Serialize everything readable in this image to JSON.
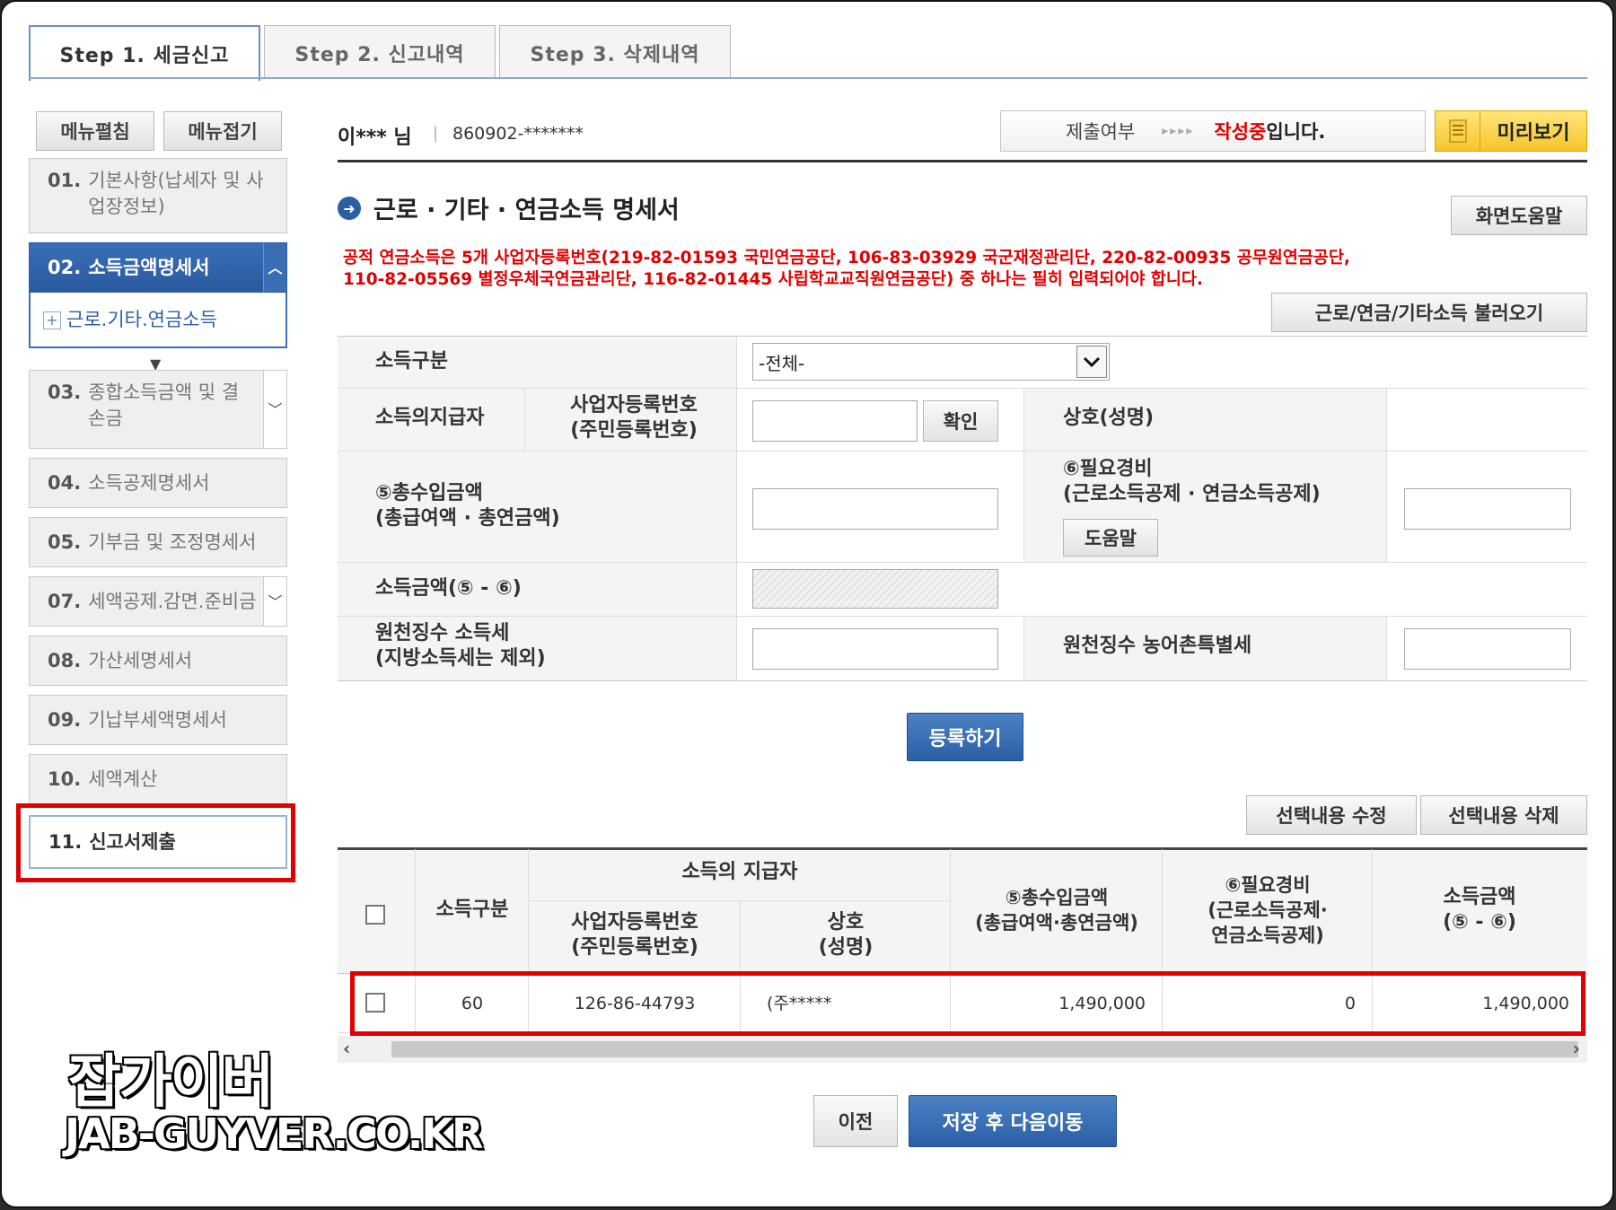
{
  "tabs": [
    "Step 1. 세금신고",
    "Step 2. 신고내역",
    "Step 3. 삭제내역"
  ],
  "sidebar": {
    "expand_btn": "메뉴펼침",
    "collapse_btn": "메뉴접기",
    "items": [
      {
        "num": "01.",
        "label": "기본사항(납세자 및 사업장정보)"
      },
      {
        "num": "02.",
        "label": "소득금액명세서"
      },
      {
        "sub": "근로.기타.연금소득"
      },
      {
        "num": "03.",
        "label": "종합소득금액 및 결손금"
      },
      {
        "num": "04.",
        "label": "소득공제명세서"
      },
      {
        "num": "05.",
        "label": "기부금 및 조정명세서"
      },
      {
        "num": "07.",
        "label": "세액공제.감면.준비금"
      },
      {
        "num": "08.",
        "label": "가산세명세서"
      },
      {
        "num": "09.",
        "label": "기납부세액명세서"
      },
      {
        "num": "10.",
        "label": "세액계산"
      },
      {
        "num": "11.",
        "label": "신고서제출"
      }
    ]
  },
  "header": {
    "user": "이*** 님",
    "id_number": "860902-*******",
    "submit_label": "제출여부",
    "arrows": "▸▸▸▸",
    "status_red": "작성중",
    "status_suffix": "입니다.",
    "preview_btn": "미리보기"
  },
  "section": {
    "title": "근로 · 기타 · 연금소득 명세서",
    "help_btn": "화면도움말",
    "notice_line1": "공적 연금소득은 5개 사업자등록번호(219-82-01593 국민연금공단, 106-83-03929 국군재정관리단, 220-82-00935 공무원연금공단,",
    "notice_line2": "110-82-05569 별정우체국연금관리단, 116-82-01445 사립학교교직원연금공단) 중 하나는 필히 입력되어야 합니다.",
    "load_btn": "근로/연금/기타소득 불러오기"
  },
  "form": {
    "income_type_label": "소득구분",
    "income_type_value": "-전체-",
    "payer_label": "소득의지급자",
    "bizno_label1": "사업자등록번호",
    "bizno_label2": "(주민등록번호)",
    "confirm_btn": "확인",
    "company_label": "상호(성명)",
    "total_label1": "⑤총수입금액",
    "total_label2": "(총급여액 · 총연금액)",
    "expense_label1": "⑥필요경비",
    "expense_label2": "(근로소득공제 · 연금소득공제)",
    "help_btn": "도움말",
    "income_amount_label": "소득금액(⑤ - ⑥)",
    "withholding_label1": "원천징수 소득세",
    "withholding_label2": "(지방소득세는 제외)",
    "rural_tax_label": "원천징수 농어촌특별세",
    "register_btn": "등록하기"
  },
  "table": {
    "edit_btn": "선택내용 수정",
    "delete_btn": "선택내용 삭제",
    "headers": {
      "type": "소득구분",
      "payer": "소득의 지급자",
      "bizno1": "사업자등록번호",
      "bizno2": "(주민등록번호)",
      "company1": "상호",
      "company2": "(성명)",
      "total1": "⑤총수입금액",
      "total2": "(총급여액·총연금액)",
      "expense1": "⑥필요경비",
      "expense2": "(근로소득공제·",
      "expense3": "연금소득공제)",
      "amount1": "소득금액",
      "amount2": "(⑤ - ⑥)"
    },
    "rows": [
      {
        "type": "60",
        "bizno": "126-86-44793",
        "company": "(주*****",
        "total": "1,490,000",
        "expense": "0",
        "amount": "1,490,000"
      }
    ]
  },
  "footer": {
    "prev_btn": "이전",
    "save_next_btn": "저장 후 다음이동"
  },
  "watermark": {
    "line1": "잡가이버",
    "line2": "JAB-GUYVER.CO.KR"
  },
  "colors": {
    "accent_blue": "#2a5fa6",
    "highlight_red": "#e00000",
    "notice_red": "#e00000"
  }
}
